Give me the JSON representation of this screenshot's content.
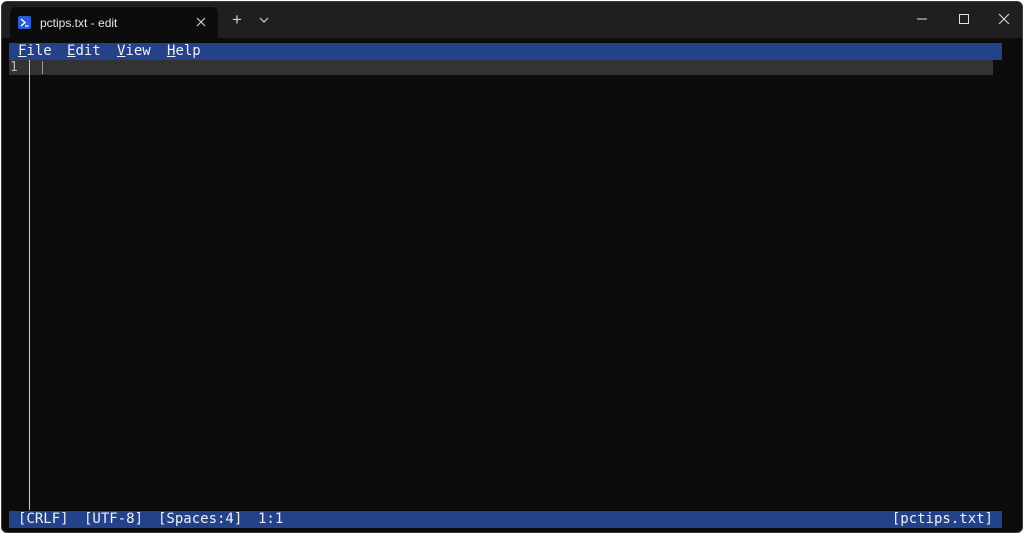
{
  "tab": {
    "title": "pctips.txt - edit",
    "icon": "powershell-icon"
  },
  "titlebar": {
    "new_tab": "+",
    "icons": [
      "close-icon",
      "chevron-down-icon",
      "minimize-icon",
      "maximize-icon",
      "close-icon"
    ]
  },
  "menu": {
    "items": [
      {
        "accel": "F",
        "rest": "ile"
      },
      {
        "accel": "E",
        "rest": "dit"
      },
      {
        "accel": "V",
        "rest": "iew"
      },
      {
        "accel": "H",
        "rest": "elp"
      }
    ]
  },
  "editor": {
    "line_number": "1"
  },
  "status": {
    "line_ending": "[CRLF]",
    "encoding": "[UTF-8]",
    "indent": "[Spaces:4]",
    "position": "1:1",
    "filename": "[pctips.txt]"
  },
  "colors": {
    "bar_blue": "#23428a",
    "editor_bg": "#0c0c0c",
    "titlebar_bg": "#1f1f1f",
    "current_line": "#333333"
  }
}
